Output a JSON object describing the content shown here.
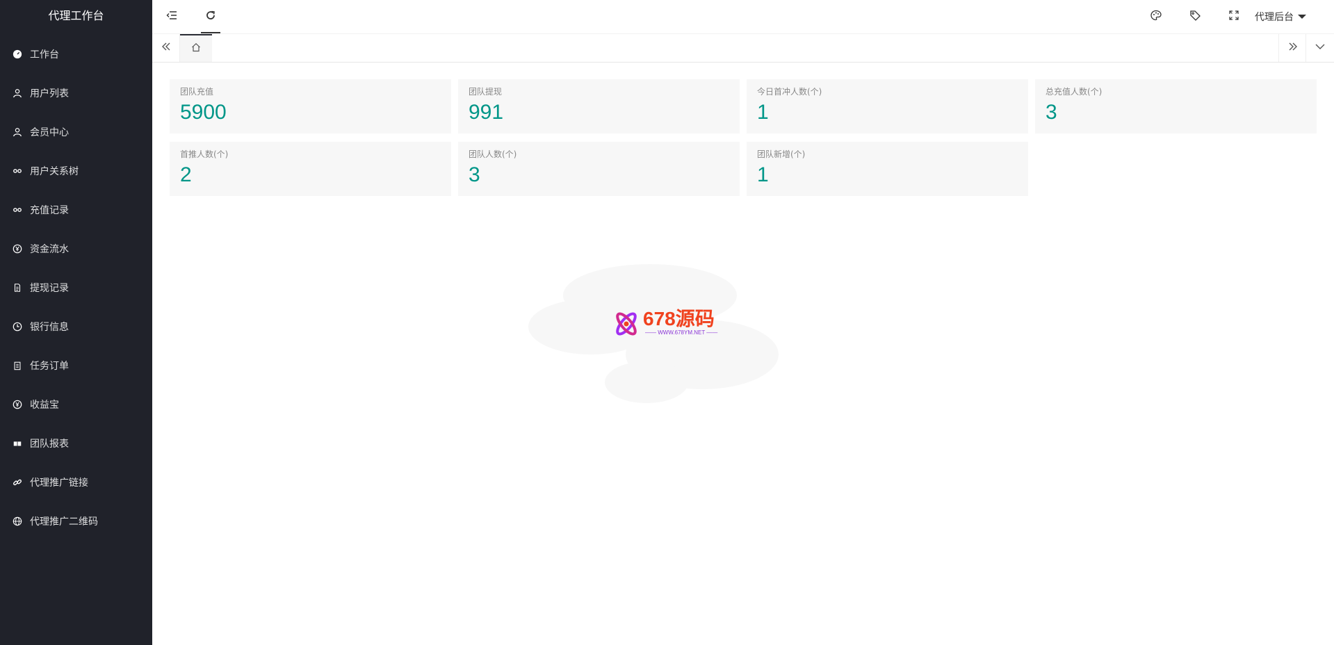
{
  "sidebar": {
    "brand": "代理工作台",
    "items": [
      {
        "label": "工作台",
        "icon": "dashboard-icon"
      },
      {
        "label": "用户列表",
        "icon": "user-icon"
      },
      {
        "label": "会员中心",
        "icon": "user-icon"
      },
      {
        "label": "用户关系树",
        "icon": "link-icon"
      },
      {
        "label": "充值记录",
        "icon": "link-icon"
      },
      {
        "label": "资金流水",
        "icon": "yen-icon"
      },
      {
        "label": "提现记录",
        "icon": "document-icon"
      },
      {
        "label": "银行信息",
        "icon": "clock-icon"
      },
      {
        "label": "任务订单",
        "icon": "clipboard-icon"
      },
      {
        "label": "收益宝",
        "icon": "yen-icon"
      },
      {
        "label": "团队报表",
        "icon": "reader-icon"
      },
      {
        "label": "代理推广链接",
        "icon": "chain-icon"
      },
      {
        "label": "代理推广二维码",
        "icon": "globe-icon"
      }
    ]
  },
  "header": {
    "agent_menu_label": "代理后台"
  },
  "stats": [
    {
      "title": "团队充值",
      "value": "5900"
    },
    {
      "title": "团队提现",
      "value": "991"
    },
    {
      "title": "今日首冲人数(个)",
      "value": "1"
    },
    {
      "title": "总充值人数(个)",
      "value": "3"
    },
    {
      "title": "首推人数(个)",
      "value": "2"
    },
    {
      "title": "团队人数(个)",
      "value": "3"
    },
    {
      "title": "团队新增(个)",
      "value": "1"
    }
  ],
  "watermark": {
    "logo_text": "678源码",
    "logo_sub": "—— WWW.678YM.NET ——"
  },
  "colors": {
    "sidebar_bg": "#20222a",
    "accent": "#009688",
    "card_bg": "#f7f7f7"
  }
}
